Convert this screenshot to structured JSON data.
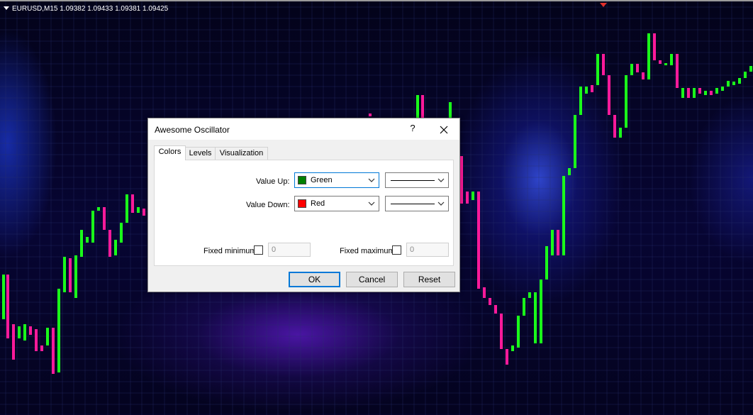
{
  "chart": {
    "symbol_info": "EURUSD,M15  1.09382 1.09433 1.09381 1.09425",
    "colors": {
      "up": "#1aff1a",
      "down": "#ff1a9a"
    }
  },
  "dialog": {
    "title": "Awesome Oscillator",
    "help_label": "?",
    "tabs": [
      {
        "label": "Colors",
        "active": true
      },
      {
        "label": "Levels",
        "active": false
      },
      {
        "label": "Visualization",
        "active": false
      }
    ],
    "value_up": {
      "label": "Value Up:",
      "color_name": "Green",
      "color": "#008000"
    },
    "value_down": {
      "label": "Value Down:",
      "color_name": "Red",
      "color": "#ff0000"
    },
    "fixed_minimum": {
      "label": "Fixed minimum",
      "checked": false,
      "value": "0"
    },
    "fixed_maximum": {
      "label": "Fixed maximum",
      "checked": false,
      "value": "0"
    },
    "buttons": {
      "ok": "OK",
      "cancel": "Cancel",
      "reset": "Reset"
    }
  }
}
